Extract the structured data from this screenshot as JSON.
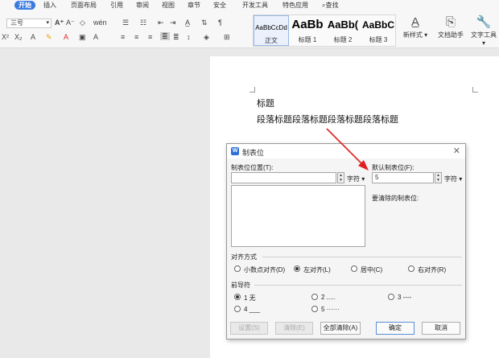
{
  "menubar": {
    "tabs": [
      "开始",
      "插入",
      "页面布局",
      "引用",
      "审阅",
      "视图",
      "章节",
      "安全",
      "开发工具",
      "特色应用"
    ],
    "search_label": "查找"
  },
  "ribbon": {
    "font_size": "三号",
    "styles": [
      {
        "sample": "AaBbCcDd",
        "name": "正文"
      },
      {
        "sample": "AaBb",
        "name": "标题 1"
      },
      {
        "sample": "AaBb(",
        "name": "标题 2"
      },
      {
        "sample": "AaBbC",
        "name": "标题 3"
      }
    ],
    "new_style_label": "新样式",
    "doc_helper_label": "文档助手",
    "text_tools_label": "文字工具"
  },
  "document": {
    "title": "标题",
    "paragraph": "段落标题段落标题段落标题段落标题"
  },
  "dialog": {
    "title": "制表位",
    "tab_position_label": "制表位位置(T):",
    "tab_position_value": "",
    "unit_label": "字符",
    "default_tab_label": "默认制表位(F):",
    "default_tab_value": "5",
    "default_unit_label": "字符",
    "clear_label": "要清除的制表位:",
    "alignment_group": "对齐方式",
    "alignment_options": [
      "小数点对齐(D)",
      "左对齐(L)",
      "居中(C)",
      "右对齐(R)"
    ],
    "alignment_selected": "左对齐(L)",
    "leader_group": "前导符",
    "leader_options": [
      "1 无",
      "2 .....",
      "3 ----",
      "4 ___",
      "5 ······"
    ],
    "leader_selected": "1 无",
    "buttons": {
      "set": "设置(S)",
      "clear": "清除(E)",
      "clear_all": "全部清除(A)",
      "ok": "确定",
      "cancel": "取消"
    }
  },
  "colors": {
    "accent": "#3a7be0",
    "annotation_arrow": "#e02020"
  }
}
